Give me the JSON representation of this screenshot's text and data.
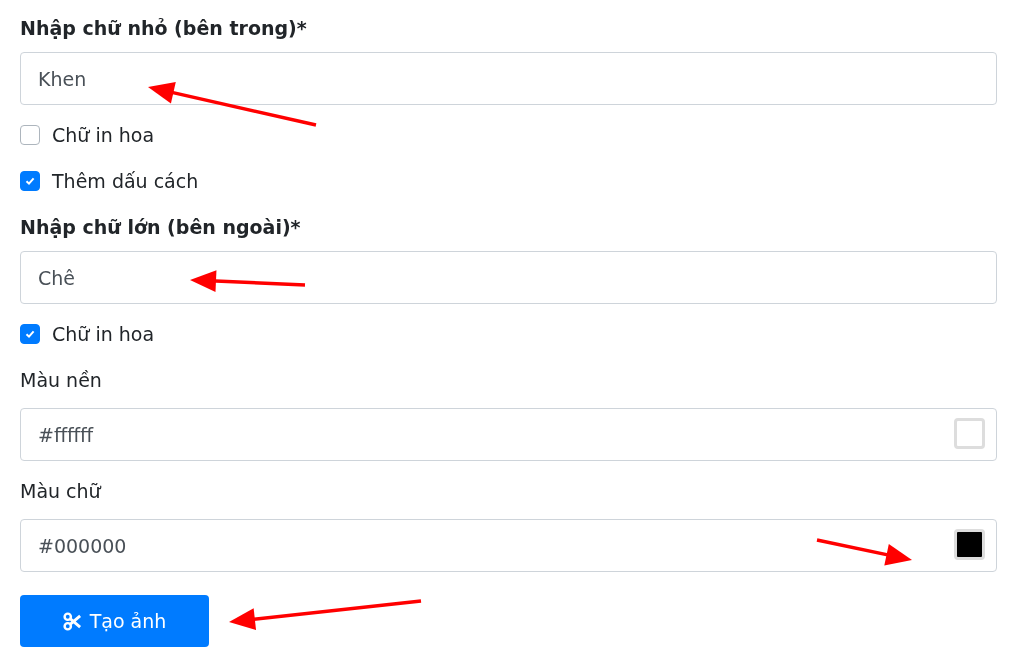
{
  "form": [
    {
      "kind": "heading",
      "text": "Nhập chữ nhỏ (bên trong)*"
    },
    {
      "kind": "text",
      "value": "Khen"
    },
    {
      "kind": "checkbox",
      "label": "Chữ in hoa",
      "checked": false
    },
    {
      "kind": "checkbox",
      "label": "Thêm dấu cách",
      "checked": true
    },
    {
      "kind": "heading",
      "text": "Nhập chữ lớn (bên ngoài)*"
    },
    {
      "kind": "text",
      "value": "Chê"
    },
    {
      "kind": "checkbox",
      "label": "Chữ in hoa",
      "checked": true
    },
    {
      "kind": "label",
      "text": "Màu nền"
    },
    {
      "kind": "color",
      "value": "#ffffff"
    },
    {
      "kind": "label",
      "text": "Màu chữ"
    },
    {
      "kind": "color",
      "value": "#000000"
    },
    {
      "kind": "button",
      "label": "Tạo ảnh"
    }
  ]
}
